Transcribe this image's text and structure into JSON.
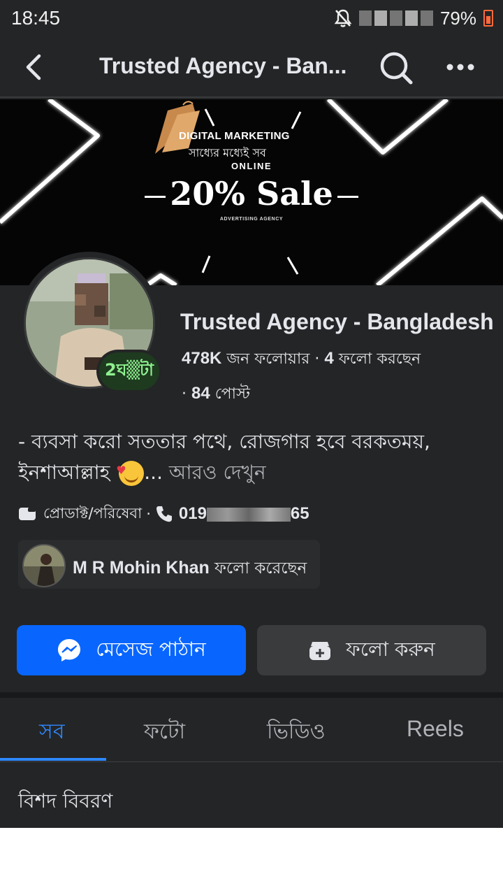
{
  "status_bar": {
    "time": "18:45",
    "battery": "79%",
    "icons": [
      "bell-off-icon",
      "battery-icon"
    ]
  },
  "header": {
    "title": "Trusted Agency - Ban...",
    "icons": [
      "back-arrow-icon",
      "search-icon",
      "more-icon"
    ]
  },
  "cover": {
    "brand": "DIGITAL MARKETING",
    "tagline": "সাধ্যের মধ্যেই সব",
    "online": "ONLINE",
    "sale": "20% Sale",
    "agency": "ADVERTISING AGENCY"
  },
  "profile": {
    "badge": "2ঘ▒টা",
    "name": "Trusted Agency - Bangladesh",
    "followers_count": "478K",
    "followers_label": "জন ফলোয়ার",
    "following_count": "4",
    "following_label": "ফলো করছেন",
    "posts_count": "84",
    "posts_label": "পোস্ট",
    "separator": "·"
  },
  "bio": {
    "text": "- ব্যবসা করো সততার পথে, রোজগার হবে বরকতময়, ইনশাআল্লাহ",
    "ellipsis": "...",
    "more": "আরও দেখুন"
  },
  "info": {
    "category": "প্রোডাক্ট/পরিষেবা",
    "phone_start": "019",
    "phone_end": "65"
  },
  "mutual": {
    "name": "M R Mohin Khan",
    "action": "ফলো করেছেন"
  },
  "actions": {
    "message": "মেসেজ পাঠান",
    "follow": "ফলো করুন"
  },
  "tabs": [
    {
      "label": "সব",
      "active": true
    },
    {
      "label": "ফটো",
      "active": false
    },
    {
      "label": "ভিডিও",
      "active": false
    },
    {
      "label": "Reels",
      "active": false
    }
  ],
  "section": {
    "title": "বিশদ বিবরণ"
  },
  "colors": {
    "accent": "#0866ff",
    "tab_active": "#2d88ff",
    "background": "#242526"
  }
}
